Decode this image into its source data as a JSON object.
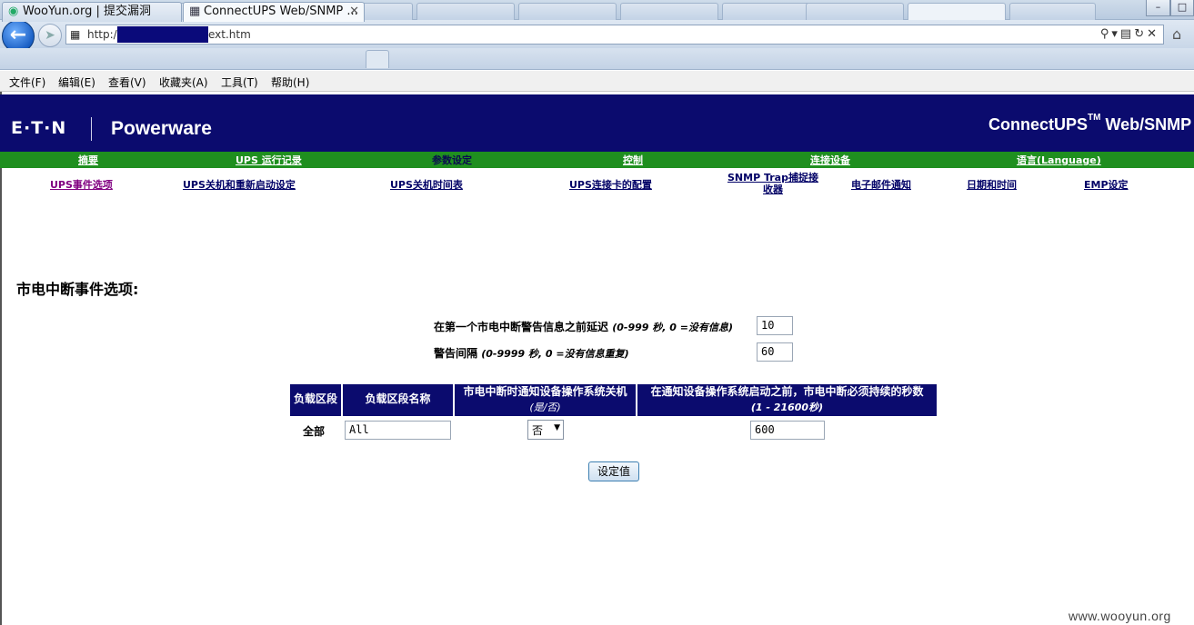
{
  "browser": {
    "url_prefix": "http:/",
    "url_suffix": "ext.htm",
    "tabs": [
      {
        "label": "WooYun.org | 提交漏洞"
      },
      {
        "label": "ConnectUPS Web/SNMP ..."
      }
    ],
    "menu": [
      "文件(F)",
      "编辑(E)",
      "查看(V)",
      "收藏夹(A)",
      "工具(T)",
      "帮助(H)"
    ]
  },
  "banner": {
    "logo": "E·T·N",
    "brand": "Powerware",
    "product": "ConnectUPS",
    "product_tm": "TM",
    "product_suffix": " Web/SNMP"
  },
  "main_nav": [
    "摘要",
    "UPS 运行记录",
    "参数设定",
    "控制",
    "连接设备",
    "语言(Language)"
  ],
  "sub_nav": [
    "UPS事件选项",
    "UPS关机和重新启动设定",
    "UPS关机时间表",
    "UPS连接卡的配置",
    "SNMP Trap捕捉接收器",
    "电子邮件通知",
    "日期和时间",
    "EMP设定"
  ],
  "section": {
    "title": "市电中断事件选项:"
  },
  "fields": {
    "delay_label": "在第一个市电中断警告信息之前延迟",
    "delay_hint": "(0-999 秒, 0 =没有信息)",
    "delay_value": "10",
    "interval_label": "警告间隔",
    "interval_hint": "(0-9999 秒, 0 =没有信息重复)",
    "interval_value": "60"
  },
  "table": {
    "headers": [
      "负载区段",
      "负载区段名称",
      "市电中断时通知设备操作系统关机",
      "(是/否)",
      "在通知设备操作系统启动之前，市电中断必须持续的秒数",
      "(1 - 21600秒)"
    ],
    "row": {
      "segment": "全部",
      "name": "All",
      "notify": "否",
      "seconds": "600"
    }
  },
  "submit_label": "设定值",
  "watermark": "www.wooyun.org"
}
